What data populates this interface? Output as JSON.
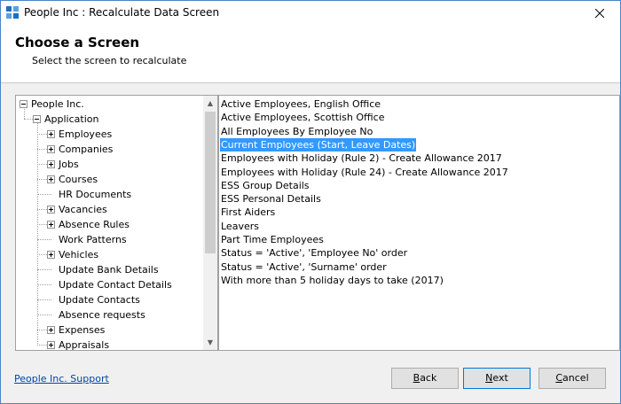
{
  "window": {
    "title": "People Inc : Recalculate Data Screen"
  },
  "header": {
    "title": "Choose a Screen",
    "subtitle": "Select the screen to recalculate"
  },
  "tree": {
    "root": "People Inc.",
    "application": "Application",
    "items": [
      {
        "label": "Employees",
        "expandable": true
      },
      {
        "label": "Companies",
        "expandable": true
      },
      {
        "label": "Jobs",
        "expandable": true
      },
      {
        "label": "Courses",
        "expandable": true
      },
      {
        "label": "HR Documents",
        "expandable": false
      },
      {
        "label": "Vacancies",
        "expandable": true
      },
      {
        "label": "Absence Rules",
        "expandable": true
      },
      {
        "label": "Work Patterns",
        "expandable": false
      },
      {
        "label": "Vehicles",
        "expandable": true
      },
      {
        "label": "Update Bank Details",
        "expandable": false
      },
      {
        "label": "Update Contact Details",
        "expandable": false
      },
      {
        "label": "Update Contacts",
        "expandable": false
      },
      {
        "label": "Absence requests",
        "expandable": false
      },
      {
        "label": "Expenses",
        "expandable": true
      },
      {
        "label": "Appraisals",
        "expandable": true
      }
    ]
  },
  "screens": [
    {
      "label": "Active Employees, English Office"
    },
    {
      "label": "Active Employees, Scottish Office"
    },
    {
      "label": "All Employees By Employee No"
    },
    {
      "label": "Current Employees (Start, Leave Dates)",
      "selected": true
    },
    {
      "label": "Employees with Holiday (Rule 2) - Create Allowance 2017"
    },
    {
      "label": "Employees with Holiday (Rule 24) - Create Allowance 2017"
    },
    {
      "label": "ESS Group Details"
    },
    {
      "label": "ESS Personal Details"
    },
    {
      "label": "First Aiders"
    },
    {
      "label": "Leavers"
    },
    {
      "label": "Part Time Employees"
    },
    {
      "label": "Status = 'Active', 'Employee No' order"
    },
    {
      "label": "Status = 'Active', 'Surname' order"
    },
    {
      "label": "With more than 5 holiday days to take (2017)"
    }
  ],
  "footer": {
    "support_link": "People Inc. Support",
    "back": {
      "accel": "B",
      "rest": "ack"
    },
    "next": {
      "accel": "N",
      "rest": "ext"
    },
    "cancel": {
      "accel": "C",
      "rest": "ancel"
    }
  },
  "colors": {
    "selection": "#3399ff",
    "link": "#0046a8",
    "default_button_border": "#0078d7"
  }
}
